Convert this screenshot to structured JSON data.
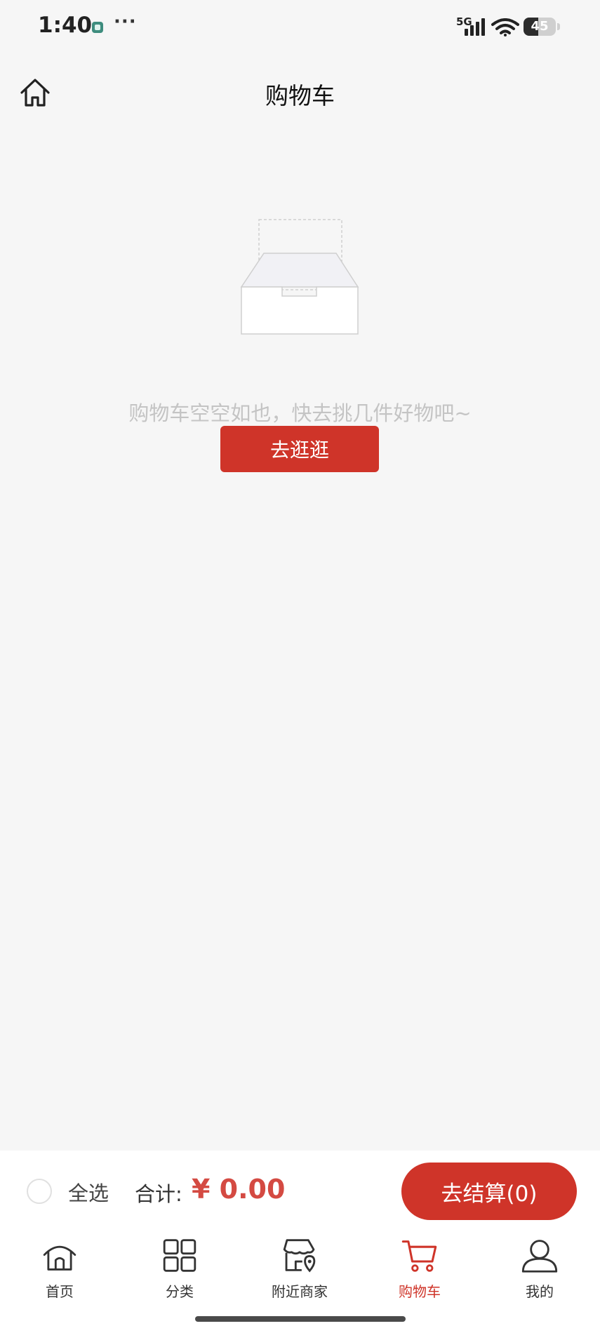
{
  "status_bar": {
    "time": "1:40",
    "network": "5G",
    "battery": 45,
    "battery_label": "45"
  },
  "header": {
    "title": "购物车",
    "home_icon": "home-icon"
  },
  "empty_state": {
    "illustration": "empty-box-icon",
    "message": "购物车空空如也，快去挑几件好物吧~",
    "button_label": "去逛逛"
  },
  "checkout_bar": {
    "select_all_label": "全选",
    "total_label": "合计:",
    "total_amount": "¥ 0.00",
    "checkout_label": "去结算(0)"
  },
  "tabs": [
    {
      "label": "首页",
      "icon": "home-icon",
      "active": false
    },
    {
      "label": "分类",
      "icon": "category-grid-icon",
      "active": false
    },
    {
      "label": "附近商家",
      "icon": "nearby-store-icon",
      "active": false
    },
    {
      "label": "购物车",
      "icon": "cart-icon",
      "active": true
    },
    {
      "label": "我的",
      "icon": "profile-icon",
      "active": false
    }
  ],
  "colors": {
    "accent": "#cf3429",
    "price": "#d44a42",
    "background": "#f6f6f6",
    "muted_text": "#c4c4c4"
  }
}
